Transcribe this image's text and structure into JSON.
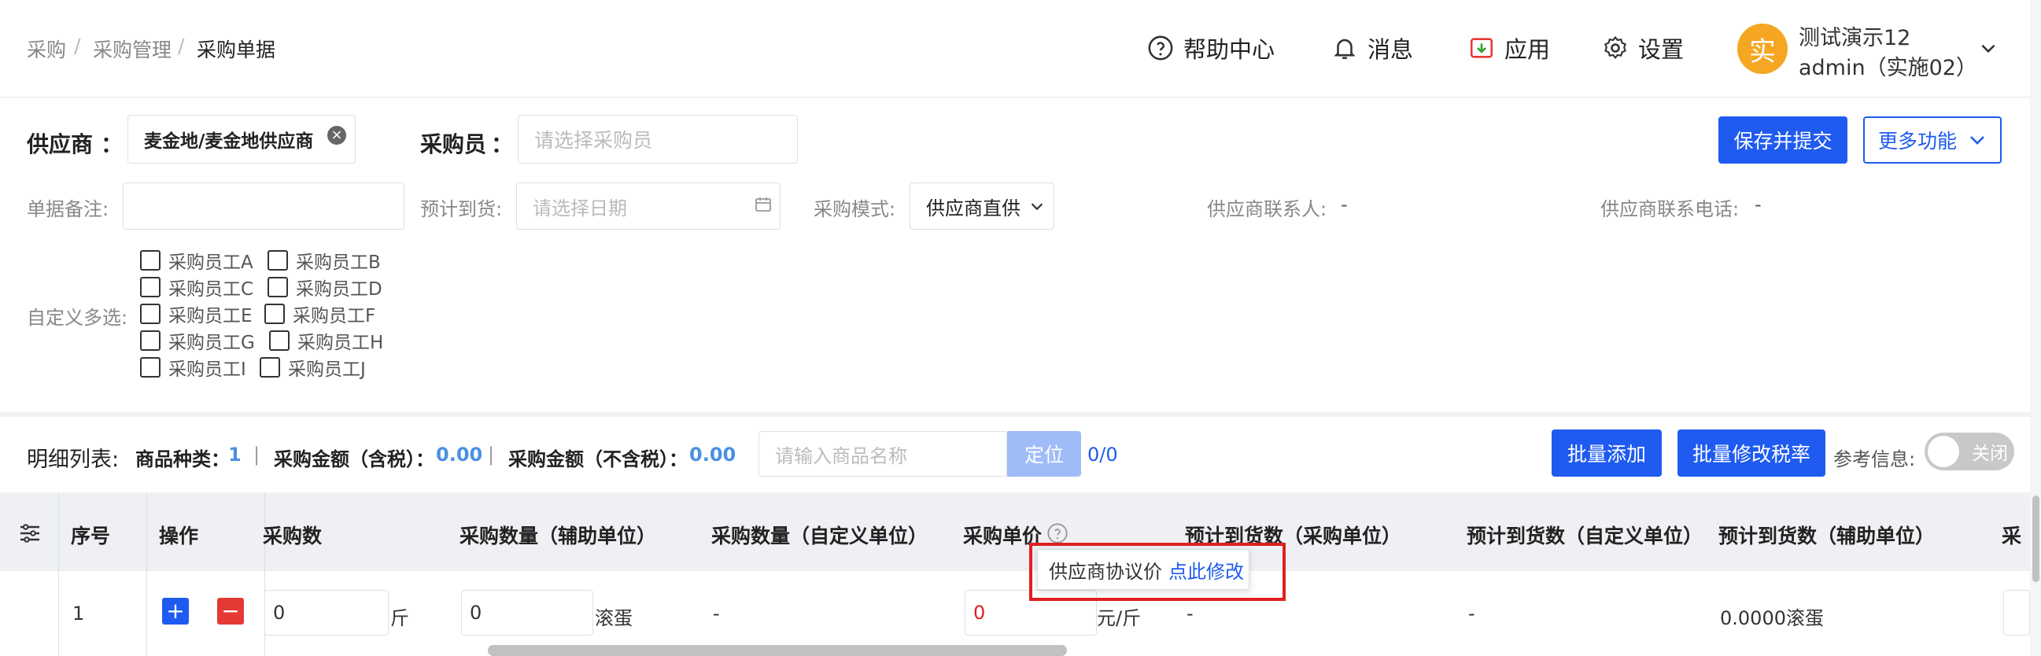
{
  "breadcrumb": {
    "items": [
      "采购",
      "采购管理",
      "采购单据"
    ],
    "separator": "/"
  },
  "header": {
    "help": "帮助中心",
    "messages": "消息",
    "apps": "应用",
    "settings": "设置",
    "avatar_char": "实",
    "user_line1": "测试演示12",
    "user_line2": "admin（实施02）"
  },
  "form": {
    "supplier_label": "供应商",
    "colon": "：",
    "supplier_value": "麦金地/麦金地供应商",
    "buyer_label": "采购员",
    "buyer_placeholder": "请选择采购员",
    "save_submit": "保存并提交",
    "more_functions": "更多功能",
    "remark_label": "单据备注:",
    "arrival_label": "预计到货:",
    "arrival_placeholder": "请选择日期",
    "mode_label": "采购模式:",
    "mode_value": "供应商直供",
    "contact_label": "供应商联系人:",
    "contact_value": "-",
    "phone_label": "供应商联系电话:",
    "phone_value": "-",
    "custom_multi_label": "自定义多选:",
    "checkboxes": [
      "采购员工A",
      "采购员工B",
      "采购员工C",
      "采购员工D",
      "采购员工E",
      "采购员工F",
      "采购员工G",
      "采购员工H",
      "采购员工I",
      "采购员工J"
    ]
  },
  "detail": {
    "list_label": "明细列表:",
    "kinds_label": "商品种类：",
    "kinds_value": "1",
    "sep": "|",
    "amount_tax_label": "采购金额（含税）：",
    "amount_tax_value": "0.00",
    "amount_notax_label": "采购金额（不含税）：",
    "amount_notax_value": "0.00",
    "search_placeholder": "请输入商品名称",
    "locate": "定位",
    "count": "0/0",
    "batch_add": "批量添加",
    "batch_tax": "批量修改税率",
    "ref_label": "参考信息:",
    "ref_toggle": "关闭"
  },
  "table": {
    "headers": [
      "序号",
      "操作",
      "采购数",
      "采购数量（辅助单位）",
      "采购数量（自定义单位）",
      "采购单价",
      "预计到货数（采购单位）",
      "预计到货数（自定义单位）",
      "预计到货数（辅助单位）",
      "采"
    ],
    "row": {
      "index": "1",
      "qty": "0",
      "qty_unit": "斤",
      "aux_qty": "0",
      "aux_unit": "滚蛋",
      "custom_qty": "-",
      "price": "0",
      "price_unit": "元/斤",
      "arrival_purchase": "-",
      "arrival_custom": "-",
      "arrival_aux": "0.0000滚蛋"
    }
  },
  "tooltip": {
    "text": "供应商协议价",
    "link": "点此修改"
  },
  "colors": {
    "primary": "#1f5bf0",
    "accent": "#f5a623",
    "danger": "#e53935",
    "highlight": "#e02020"
  }
}
